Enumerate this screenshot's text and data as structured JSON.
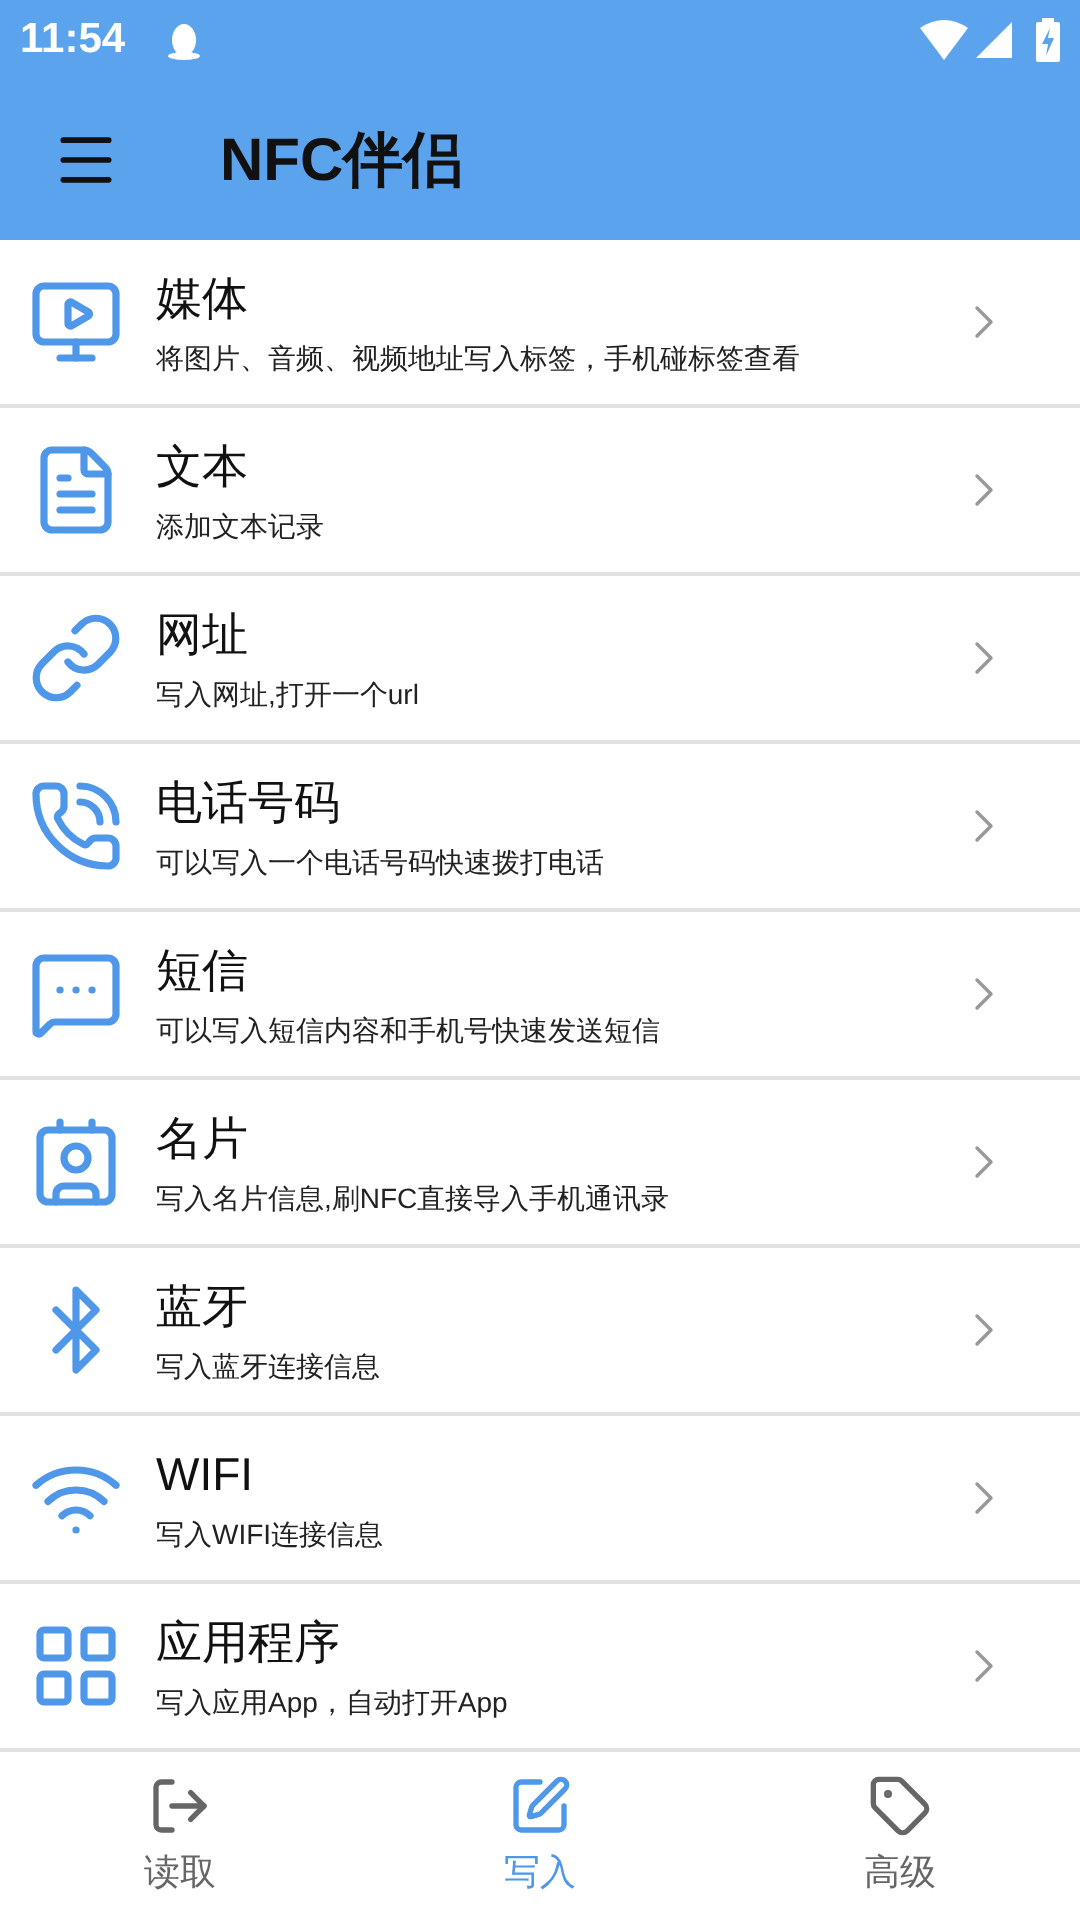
{
  "status_bar": {
    "time": "11:54"
  },
  "app_bar": {
    "title": "NFC伴侣"
  },
  "items": [
    {
      "title": "媒体",
      "subtitle": "将图片、音频、视频地址写入标签，手机碰标签查看"
    },
    {
      "title": "文本",
      "subtitle": "添加文本记录"
    },
    {
      "title": "网址",
      "subtitle": "写入网址,打开一个url"
    },
    {
      "title": "电话号码",
      "subtitle": "可以写入一个电话号码快速拨打电话"
    },
    {
      "title": "短信",
      "subtitle": "可以写入短信内容和手机号快速发送短信"
    },
    {
      "title": "名片",
      "subtitle": "写入名片信息,刷NFC直接导入手机通讯录"
    },
    {
      "title": "蓝牙",
      "subtitle": "写入蓝牙连接信息"
    },
    {
      "title": "WIFI",
      "subtitle": "写入WIFI连接信息"
    },
    {
      "title": "应用程序",
      "subtitle": "写入应用App，自动打开App"
    }
  ],
  "bottom_nav": [
    {
      "label": "读取",
      "selected": false
    },
    {
      "label": "写入",
      "selected": true
    },
    {
      "label": "高级",
      "selected": false
    }
  ]
}
